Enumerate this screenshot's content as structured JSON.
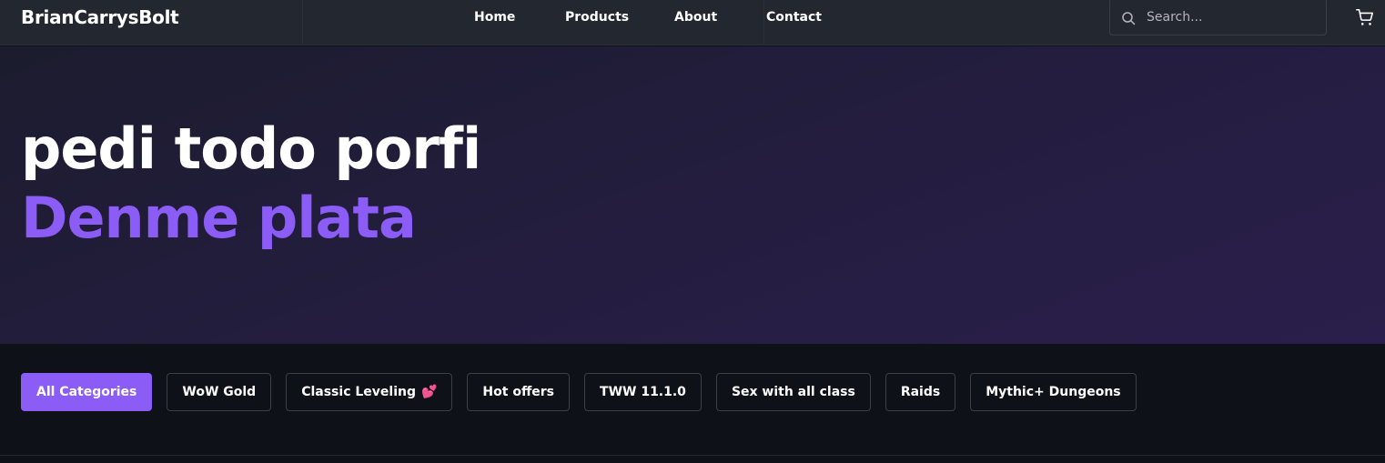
{
  "header": {
    "brand": "BrianCarrysBolt",
    "nav": [
      "Home",
      "Products",
      "About",
      "Contact"
    ],
    "search_placeholder": "Search..."
  },
  "hero": {
    "line1": "pedi todo porfi",
    "line2": "Denme plata"
  },
  "categories": [
    {
      "label": "All Categories",
      "active": true
    },
    {
      "label": "WoW Gold",
      "active": false
    },
    {
      "label": "Classic Leveling",
      "active": false,
      "emoji": "💕"
    },
    {
      "label": "Hot offers",
      "active": false
    },
    {
      "label": "TWW 11.1.0",
      "active": false
    },
    {
      "label": "Sex with all class",
      "active": false
    },
    {
      "label": "Raids",
      "active": false
    },
    {
      "label": "Mythic+ Dungeons",
      "active": false
    }
  ],
  "colors": {
    "accent": "#8b5cf6",
    "header_bg": "#232730",
    "page_bg": "#0e1117"
  },
  "icons": {
    "search": "search-icon",
    "cart": "cart-icon"
  }
}
